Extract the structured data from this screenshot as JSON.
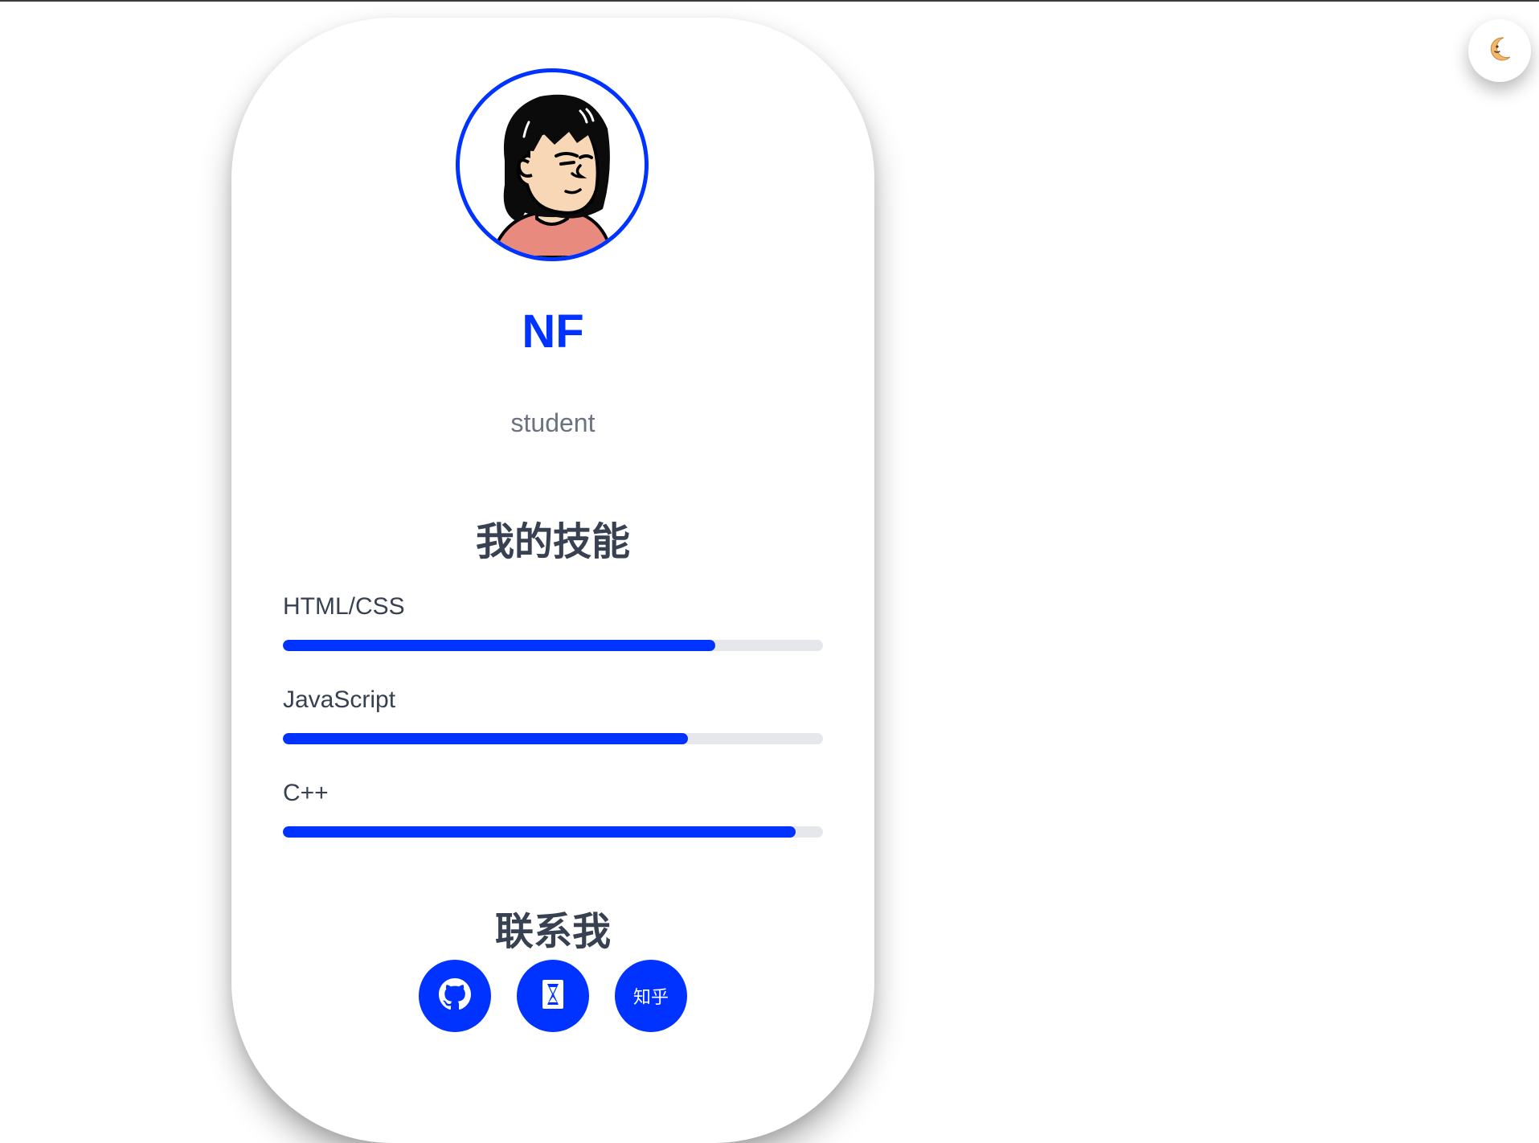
{
  "profile": {
    "name": "NF",
    "role": "student"
  },
  "skills": {
    "title": "我的技能",
    "items": [
      {
        "label": "HTML/CSS",
        "level": 0.8
      },
      {
        "label": "JavaScript",
        "level": 0.75
      },
      {
        "label": "C++",
        "level": 0.95
      }
    ]
  },
  "contact": {
    "title": "联系我",
    "buttons": [
      {
        "icon": "github-icon"
      },
      {
        "icon": "hourglass-icon"
      },
      {
        "label": "知乎"
      }
    ]
  },
  "theme_toggle": {
    "icon": "crescent-moon-icon"
  },
  "colors": {
    "accent": "#0033ff",
    "track": "#e5e7eb",
    "heading": "#374151",
    "muted": "#6b7280"
  }
}
